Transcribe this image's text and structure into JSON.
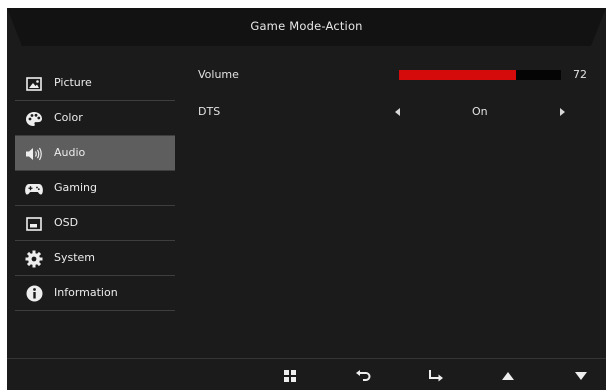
{
  "header": {
    "title": "Game Mode-Action"
  },
  "sidebar": {
    "items": [
      {
        "label": "Picture",
        "icon": "picture-icon",
        "active": false
      },
      {
        "label": "Color",
        "icon": "color-palette-icon",
        "active": false
      },
      {
        "label": "Audio",
        "icon": "speaker-icon",
        "active": true
      },
      {
        "label": "Gaming",
        "icon": "gamepad-icon",
        "active": false
      },
      {
        "label": "OSD",
        "icon": "osd-window-icon",
        "active": false
      },
      {
        "label": "System",
        "icon": "gear-icon",
        "active": false
      },
      {
        "label": "Information",
        "icon": "info-icon",
        "active": false
      }
    ]
  },
  "main": {
    "volume": {
      "label": "Volume",
      "value": "72",
      "level_percent": 72,
      "fill_color": "#d50b0b"
    },
    "dts": {
      "label": "DTS",
      "value": "On"
    }
  },
  "footer": {
    "buttons": [
      {
        "icon": "menu-grid-icon"
      },
      {
        "icon": "back-arrow-icon"
      },
      {
        "icon": "enter-arrow-icon"
      },
      {
        "icon": "up-arrow-icon"
      },
      {
        "icon": "down-arrow-icon"
      }
    ]
  },
  "colors": {
    "background": "#1b1b1b",
    "highlight": "#5e5e5e",
    "accent": "#d50b0b"
  }
}
